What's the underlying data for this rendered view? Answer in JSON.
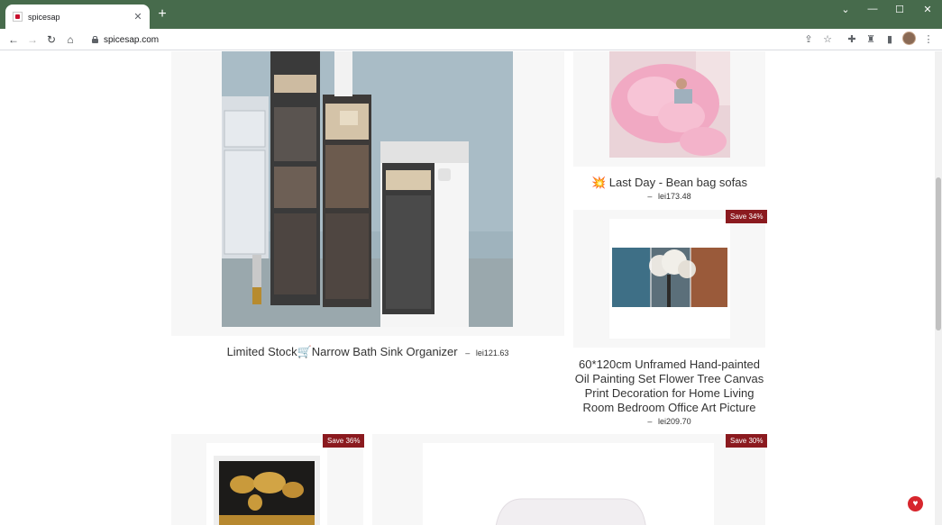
{
  "browser": {
    "tab_title": "spicesap",
    "new_tab_icon": "+",
    "url": "spicesap.com",
    "window_controls": [
      "chevron-down-icon",
      "minimize-icon",
      "maximize-icon",
      "close-icon"
    ],
    "toolbar_icons": [
      "share-icon",
      "star-icon",
      "extensions-icon",
      "extension-tool-icon",
      "sidepanel-icon",
      "profile-avatar",
      "menu-icon"
    ]
  },
  "products": [
    {
      "title": "Limited Stock🛒Narrow Bath Sink Organizer",
      "price_dash": "–",
      "price": "lei121.63",
      "badge": ""
    },
    {
      "title": "💥 Last Day - Bean bag sofas",
      "price_dash": "–",
      "price": "lei173.48",
      "badge": ""
    },
    {
      "title": "60*120cm Unframed Hand-painted Oil Painting Set Flower Tree Canvas Print Decoration for Home Living Room Bedroom Office Art Picture",
      "price_dash": "–",
      "price": "lei209.70",
      "badge": "Save 34%"
    },
    {
      "title": "",
      "price_dash": "",
      "price": "",
      "badge": "Save 36%"
    },
    {
      "title": "",
      "price_dash": "",
      "price": "",
      "badge": "Save 30%"
    }
  ],
  "colors": {
    "chrome": "#476b4c",
    "badge": "#8b1a1f",
    "card_bg": "#f7f7f7"
  }
}
